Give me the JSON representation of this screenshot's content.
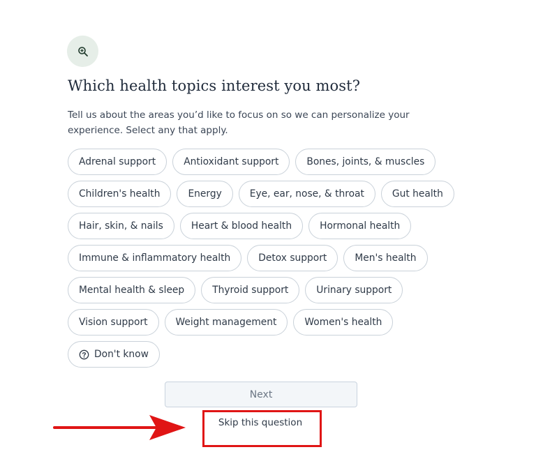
{
  "header": {
    "icon": "zoom-in-icon",
    "title": "Which health topics interest you most?",
    "subtitle": "Tell us about the areas you’d like to focus on so we can personalize your experience. Select any that apply."
  },
  "topics": [
    {
      "label": "Adrenal support"
    },
    {
      "label": "Antioxidant support"
    },
    {
      "label": "Bones, joints, & muscles"
    },
    {
      "label": "Children's health"
    },
    {
      "label": "Energy"
    },
    {
      "label": "Eye, ear, nose, & throat"
    },
    {
      "label": "Gut health"
    },
    {
      "label": "Hair, skin, & nails"
    },
    {
      "label": "Heart & blood health"
    },
    {
      "label": "Hormonal health"
    },
    {
      "label": "Immune & inflammatory health"
    },
    {
      "label": "Detox support"
    },
    {
      "label": "Men's health"
    },
    {
      "label": "Mental health & sleep"
    },
    {
      "label": "Thyroid support"
    },
    {
      "label": "Urinary support"
    },
    {
      "label": "Vision support"
    },
    {
      "label": "Weight management"
    },
    {
      "label": "Women's health"
    },
    {
      "label": "Don't know",
      "icon": "question-circle-icon"
    }
  ],
  "actions": {
    "next_label": "Next",
    "skip_label": "Skip this question"
  },
  "annotation": {
    "highlight_color": "#e01515",
    "arrow_color": "#e01515"
  },
  "colors": {
    "icon_background": "#e6eee8",
    "chip_border": "#c9d1d9",
    "next_background": "#f3f6f9"
  }
}
